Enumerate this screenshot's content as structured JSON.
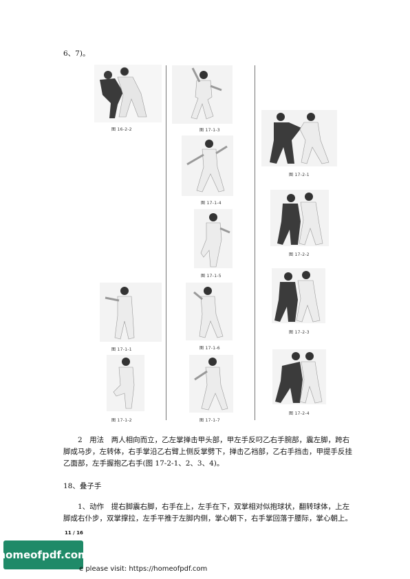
{
  "top_text": "6、7)。",
  "captions": {
    "c16_2_2": "图 16-2-2",
    "c17_1_3": "图 17-1-3",
    "c17_1_4": "图 17-1-4",
    "c17_1_5": "图 17-1-5",
    "c17_1_1": "图 17-1-1",
    "c17_1_6": "图 17-1-6",
    "c17_1_2": "图 17-1-2",
    "c17_1_7": "图 17-1-7",
    "c17_2_1": "图 17-2-1",
    "c17_2_2": "图 17-2-2",
    "c17_2_3": "图 17-2-3",
    "c17_2_4": "图 17-2-4"
  },
  "para1_line1": "2　用法　两人相向而立，乙左掌掸击甲头部，甲左手反叼乙右手腕部，震左脚，跨右",
  "para1_line2": "脚成马步，左转体，右手掌沿乙右臂上侧反掌劈下，掸击乙裆部，乙右手挡击，甲提手反挂",
  "para1_line3": "乙面部，左手握抱乙右手(图 17-2-1、2、3、4)。",
  "heading": "18、叠子手",
  "para2_line1": "1、动作　提右脚震右脚，右手在上，左手在下，双掌相对似抱球状，翻转球体，上左",
  "para2_line2": "脚成右仆步，双掌撑拉，左手平推于左脚内侧，掌心朝下，右手掌回落于腰际，掌心朝上。",
  "page_number": "11 / 16",
  "logo_text": "homeofpdf.com",
  "visit_text": "e please visit: https://homeofpdf.com"
}
